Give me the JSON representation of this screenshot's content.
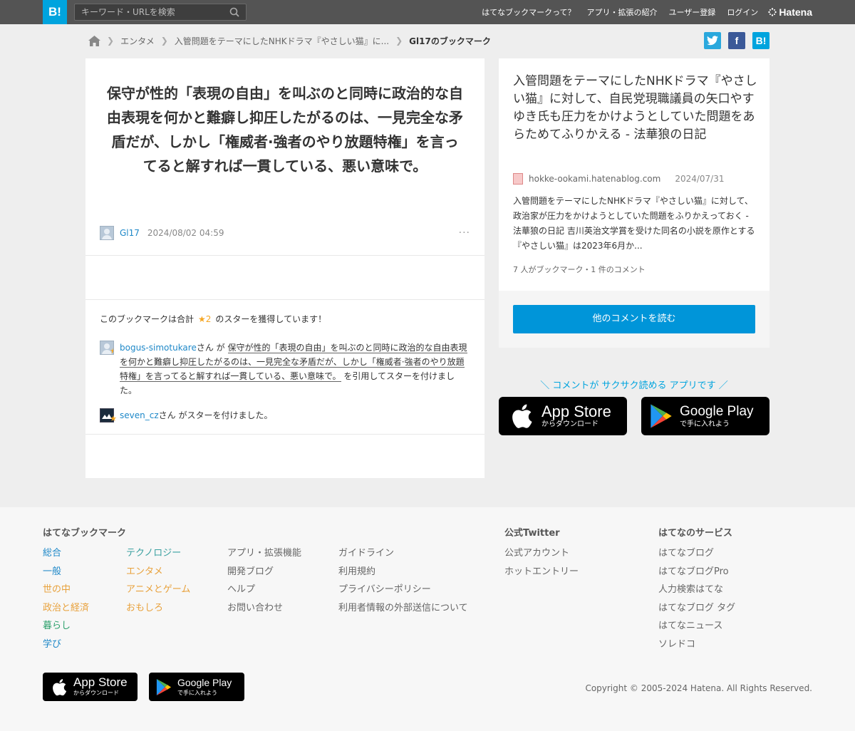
{
  "header": {
    "logo": "B!",
    "search_placeholder": "キーワード・URLを検索",
    "nav": [
      "はてなブックマークって？",
      "アプリ・拡張の紹介",
      "ユーザー登録",
      "ログイン"
    ],
    "brand": "Hatena"
  },
  "breadcrumb": {
    "items": [
      "エンタメ",
      "入管問題をテーマにしたNHKドラマ『やさしい猫』に...",
      "Gl17のブックマーク"
    ]
  },
  "share": {
    "twitter": "t",
    "facebook": "f",
    "hatena": "B!"
  },
  "bookmark": {
    "comment": "保守が性的「表現の自由」を叫ぶのと同時に政治的な自由表現を何かと難癖し抑圧したがるのは、一見完全な矛盾だが、しかし「権威者·強者のやり放題特権」を言ってると解すれば一貫している、悪い意味で。",
    "user": "Gl17",
    "date": "2024/08/02 04:59",
    "menu": "···"
  },
  "stars": {
    "summary_prefix": "このブックマークは合計",
    "summary_count": "★2",
    "summary_suffix": "のスターを獲得しています！",
    "entries": [
      {
        "user": "bogus-simotukare",
        "verb1": "さん が",
        "quote": "保守が性的「表現の自由」を叫ぶのと同時に政治的な自由表現を何かと難癖し抑圧したがるのは、一見完全な矛盾だが、しかし「権威者·強者のやり放題特権」を言ってると解すれば一貫している、悪い意味で。",
        "verb2": "を引用してスターを付けました。"
      },
      {
        "user": "seven_cz",
        "verb1": "さん がスターを付けました。"
      }
    ]
  },
  "entry": {
    "title": "入管問題をテーマにしたNHKドラマ『やさしい猫』に対して、自民党現職議員の矢口やすゆき氏も圧力をかけようとしていた問題をあらためてふりかえる - 法華狼の日記",
    "domain": "hokke-ookami.hatenablog.com",
    "date": "2024/07/31",
    "description": "入管問題をテーマにしたNHKドラマ『やさしい猫』に対して、政治家が圧力をかけようとしていた問題をふりかえっておく - 法華狼の日記 吉川英治文学賞を受けた同名の小説を原作とする『やさしい猫』は2023年6月か...",
    "count": "7 人がブックマーク・1 件のコメント",
    "read_button": "他のコメントを読む"
  },
  "app_promo": {
    "tagline": "＼ コメントが サクサク読める アプリです ／",
    "appstore_main": "App Store",
    "appstore_sub": "からダウンロード",
    "googleplay_main": "Google Play",
    "googleplay_sub": "で手に入れよう"
  },
  "footer": {
    "col1_title": "はてなブックマーク",
    "col1a": [
      "総合",
      "一般",
      "世の中",
      "政治と経済",
      "暮らし",
      "学び"
    ],
    "col1b": [
      "テクノロジー",
      "エンタメ",
      "アニメとゲーム",
      "おもしろ"
    ],
    "col1c": [
      "アプリ・拡張機能",
      "開発ブログ",
      "ヘルプ",
      "お問い合わせ"
    ],
    "col1d": [
      "ガイドライン",
      "利用規約",
      "プライバシーポリシー",
      "利用者情報の外部送信について"
    ],
    "col2_title": "公式Twitter",
    "col2": [
      "公式アカウント",
      "ホットエントリー"
    ],
    "col3_title": "はてなのサービス",
    "col3": [
      "はてなブログ",
      "はてなブログPro",
      "人力検索はてな",
      "はてなブログ タグ",
      "はてなニュース",
      "ソレドコ"
    ],
    "copyright": "Copyright © 2005-2024 Hatena. All Rights Reserved."
  }
}
